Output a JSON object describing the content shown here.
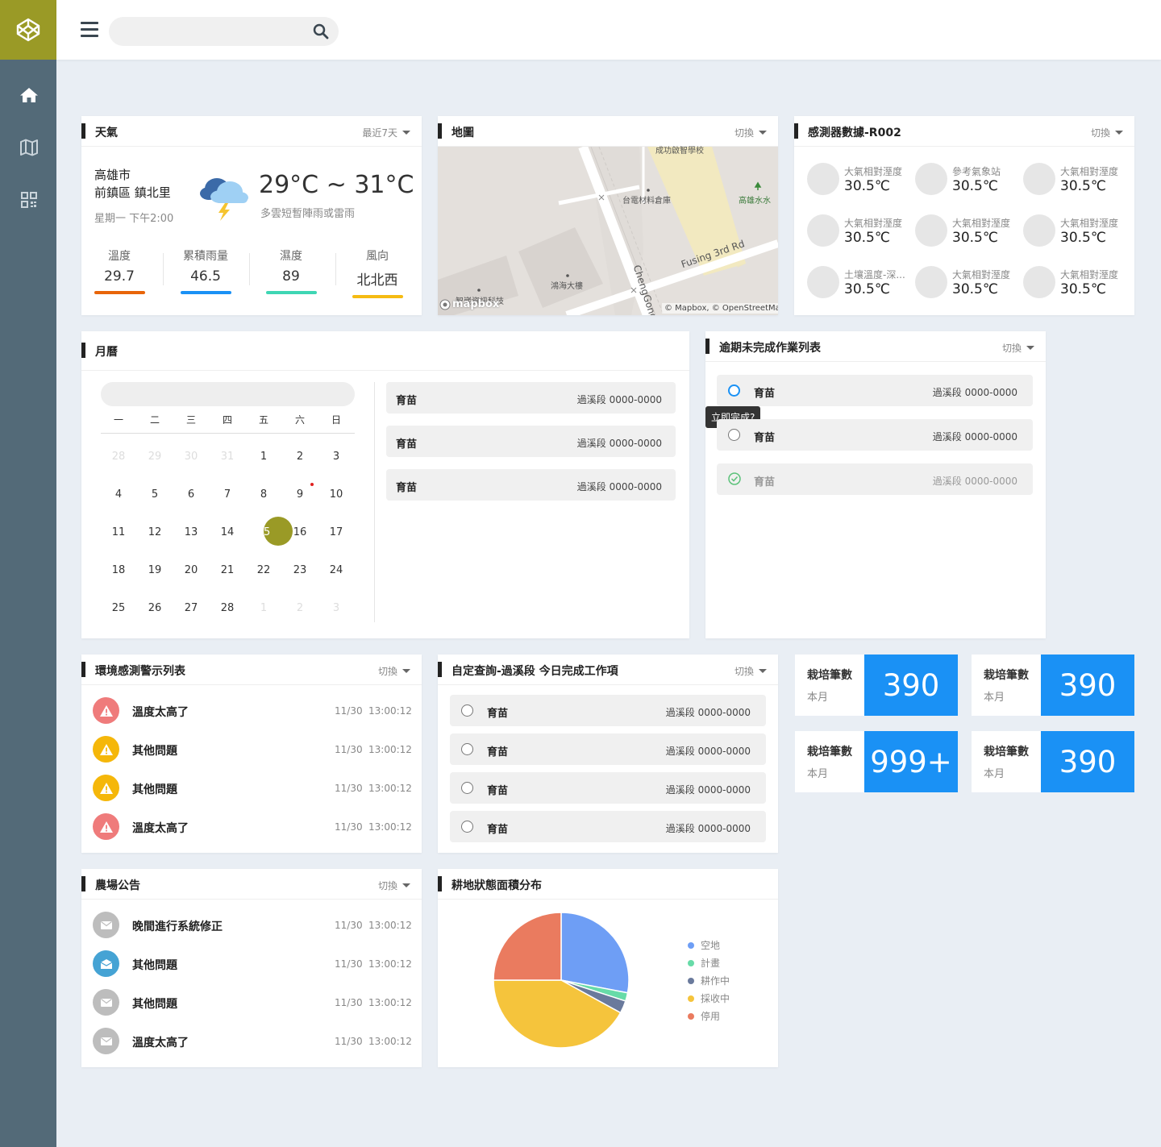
{
  "nav": {
    "items": [
      "home-icon",
      "map-icon",
      "qrcode-icon"
    ]
  },
  "weather": {
    "title": "天氣",
    "range": "最近7天",
    "city": "高雄市",
    "district": "前鎮區 鎮北里",
    "time": "星期一 下午2:00",
    "temp": "29°C ~ 31°C",
    "desc": "多雲短暫陣雨或雷雨",
    "stats": [
      {
        "label": "溫度",
        "value": "29.7",
        "color": "#e8650a"
      },
      {
        "label": "累積雨量",
        "value": "46.5",
        "color": "#1a91f5"
      },
      {
        "label": "濕度",
        "value": "89",
        "color": "#3ed6b4"
      },
      {
        "label": "風向",
        "value": "北北西",
        "color": "#f5bb12"
      }
    ]
  },
  "map": {
    "title": "地圖",
    "switch": "切換",
    "labels": {
      "school": "成功啟智學校",
      "warehouse": "台電材料倉庫",
      "water": "高雄水水",
      "building": "鴻海大樓",
      "tech": "智崴資訊科技",
      "road1": "Fusing 3rd Rd",
      "road2": "ChengGong",
      "attribution": "© Mapbox, © OpenStreetMap",
      "brand": "mapbox"
    }
  },
  "sensors": {
    "title": "感測器數據-R002",
    "switch": "切換",
    "items": [
      {
        "label": "大氣相對溼度",
        "value": "30.5℃"
      },
      {
        "label": "參考氣象站",
        "value": "30.5℃"
      },
      {
        "label": "大氣相對溼度",
        "value": "30.5℃"
      },
      {
        "label": "大氣相對溼度",
        "value": "30.5℃"
      },
      {
        "label": "大氣相對溼度",
        "value": "30.5℃"
      },
      {
        "label": "大氣相對溼度",
        "value": "30.5℃"
      },
      {
        "label": "土壤溫度-深...",
        "value": "30.5℃"
      },
      {
        "label": "大氣相對溼度",
        "value": "30.5℃"
      },
      {
        "label": "大氣相對溼度",
        "value": "30.5℃"
      }
    ]
  },
  "calendar": {
    "title": "月曆",
    "weekdays": [
      "一",
      "二",
      "三",
      "四",
      "五",
      "六",
      "日"
    ],
    "weeks": [
      [
        "28",
        "29",
        "30",
        "31",
        "1",
        "2",
        "3"
      ],
      [
        "4",
        "5",
        "6",
        "7",
        "8",
        "9",
        "10"
      ],
      [
        "11",
        "12",
        "13",
        "14",
        "15",
        "16",
        "17"
      ],
      [
        "18",
        "19",
        "20",
        "21",
        "22",
        "23",
        "24"
      ],
      [
        "25",
        "26",
        "27",
        "28",
        "1",
        "2",
        "3"
      ]
    ],
    "events": [
      {
        "name": "育苗",
        "loc": "過溪段 0000-0000"
      },
      {
        "name": "育苗",
        "loc": "過溪段 0000-0000"
      },
      {
        "name": "育苗",
        "loc": "過溪段 0000-0000"
      }
    ]
  },
  "overdue": {
    "title": "逾期未完成作業列表",
    "switch": "切換",
    "tooltip": "立即完成?",
    "items": [
      {
        "name": "育苗",
        "loc": "過溪段 0000-0000"
      },
      {
        "name": "育苗",
        "loc": "過溪段 0000-0000"
      },
      {
        "name": "育苗",
        "loc": "過溪段 0000-0000"
      }
    ]
  },
  "alerts": {
    "title": "環境感測警示列表",
    "switch": "切換",
    "items": [
      {
        "text": "溫度太高了",
        "date": "11/30",
        "time": "13:00:12",
        "color": "#ef7b7b"
      },
      {
        "text": "其他問題",
        "date": "11/30",
        "time": "13:00:12",
        "color": "#f5b70a"
      },
      {
        "text": "其他問題",
        "date": "11/30",
        "time": "13:00:12",
        "color": "#f5b70a"
      },
      {
        "text": "溫度太高了",
        "date": "11/30",
        "time": "13:00:12",
        "color": "#ef7b7b"
      }
    ]
  },
  "query": {
    "title": "自定查詢-過溪段 今日完成工作項",
    "switch": "切換",
    "items": [
      {
        "name": "育苗",
        "loc": "過溪段 0000-0000"
      },
      {
        "name": "育苗",
        "loc": "過溪段 0000-0000"
      },
      {
        "name": "育苗",
        "loc": "過溪段 0000-0000"
      },
      {
        "name": "育苗",
        "loc": "過溪段 0000-0000"
      }
    ]
  },
  "stats": [
    {
      "label": "栽培筆數",
      "sub": "本月",
      "value": "390"
    },
    {
      "label": "栽培筆數",
      "sub": "本月",
      "value": "390"
    },
    {
      "label": "栽培筆數",
      "sub": "本月",
      "value": "999+"
    },
    {
      "label": "栽培筆數",
      "sub": "本月",
      "value": "390"
    }
  ],
  "notices": {
    "title": "農場公告",
    "switch": "切換",
    "items": [
      {
        "text": "晚間進行系統修正",
        "date": "11/30",
        "time": "13:00:12",
        "color": "#bdbdbd"
      },
      {
        "text": "其他問題",
        "date": "11/30",
        "time": "13:00:12",
        "color": "#45a3d4"
      },
      {
        "text": "其他問題",
        "date": "11/30",
        "time": "13:00:12",
        "color": "#bdbdbd"
      },
      {
        "text": "溫度太高了",
        "date": "11/30",
        "time": "13:00:12",
        "color": "#bdbdbd"
      }
    ]
  },
  "chart_data": {
    "type": "pie",
    "title": "耕地狀態面積分布",
    "categories": [
      "空地",
      "計畫",
      "耕作中",
      "採收中",
      "停用"
    ],
    "values": [
      28,
      2,
      3,
      42,
      25
    ],
    "colors": [
      "#6e9ef5",
      "#67dba8",
      "#6a7a9c",
      "#f5c43c",
      "#ea7b5f"
    ]
  }
}
